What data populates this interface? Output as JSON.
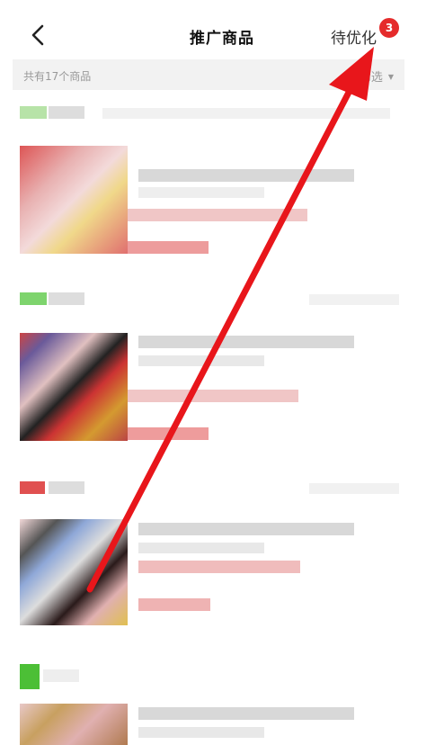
{
  "header": {
    "title": "推广商品",
    "pending_label": "待优化",
    "pending_count": "3"
  },
  "subbar": {
    "count_text": "共有17个商品",
    "filter_label": "筛选",
    "filter_caret": "▼"
  },
  "icons": {
    "back": "chevron-left-icon",
    "filter_caret": "triangle-down-icon"
  },
  "colors": {
    "accent_red": "#e52b2b",
    "annotation_arrow": "#e8161b",
    "subbar_bg": "#f2f2f2"
  }
}
